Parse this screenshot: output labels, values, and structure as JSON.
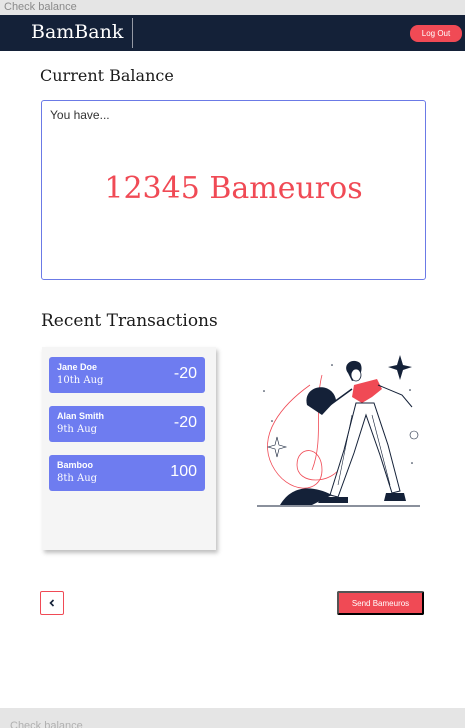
{
  "frame": {
    "label": "Check balance",
    "bottom_label": "Check balance"
  },
  "navbar": {
    "brand": "BamBank",
    "logout_label": "Log Out"
  },
  "balance": {
    "title": "Current Balance",
    "intro": "You have...",
    "amount": "12345 Bameuros"
  },
  "transactions": {
    "title": "Recent Transactions",
    "items": [
      {
        "name": "Jane Doe",
        "date": "10th Aug",
        "amount": "-20"
      },
      {
        "name": "Alan Smith",
        "date": "9th Aug",
        "amount": "-20"
      },
      {
        "name": "Bamboo",
        "date": "8th Aug",
        "amount": "100"
      }
    ]
  },
  "footer": {
    "back_icon": "chevron-left-icon",
    "send_label": "Send Bameuros"
  },
  "colors": {
    "navy": "#142138",
    "accent_red": "#f04a55",
    "card_blue": "#6e7cf0",
    "border_blue": "#6b7ae6"
  }
}
